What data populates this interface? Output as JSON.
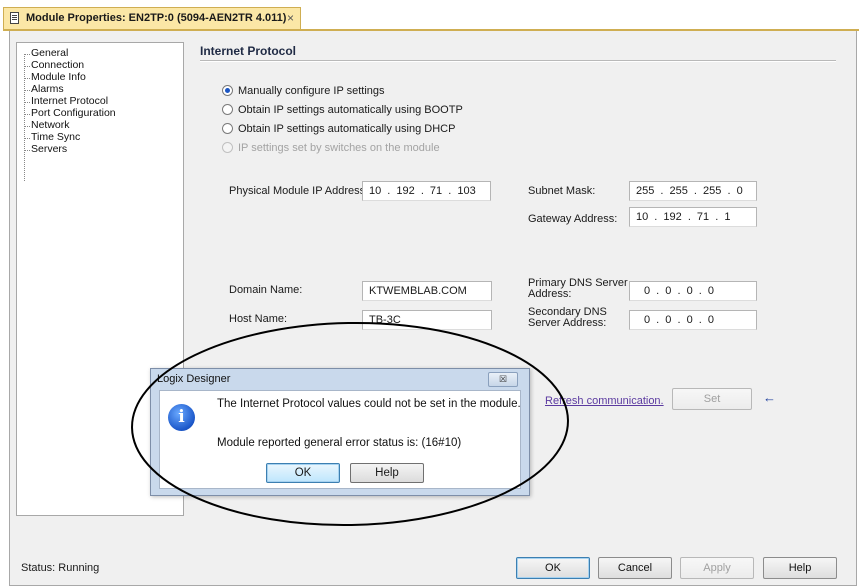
{
  "tab": {
    "title": "Module Properties: EN2TP:0 (5094-AEN2TR 4.011)",
    "close_glyph": "×"
  },
  "tree": {
    "items": [
      "General",
      "Connection",
      "Module Info",
      "Alarms",
      "Internet Protocol",
      "Port Configuration",
      "Network",
      "Time Sync",
      "Servers"
    ]
  },
  "section": {
    "title": "Internet Protocol"
  },
  "radios": [
    {
      "label": "Manually configure IP settings",
      "checked": true,
      "disabled": false
    },
    {
      "label": "Obtain IP settings automatically using BOOTP",
      "checked": false,
      "disabled": false
    },
    {
      "label": "Obtain IP settings automatically using DHCP",
      "checked": false,
      "disabled": false
    },
    {
      "label": "IP settings set by switches on the module",
      "checked": false,
      "disabled": true
    }
  ],
  "fields": {
    "ip_label": "Physical Module IP Address:",
    "ip_value": "10 . 192 . 71 . 103",
    "subnet_label": "Subnet Mask:",
    "subnet_value": "255 . 255 . 255 . 0",
    "gateway_label": "Gateway Address:",
    "gateway_value": "10 . 192 . 71 . 1",
    "domain_label": "Domain Name:",
    "domain_value": "KTWEMBLAB.COM",
    "host_label": "Host Name:",
    "host_value": "TB-3C",
    "primary_dns_label_1": "Primary DNS Server",
    "primary_dns_label_2": "Address:",
    "primary_dns_value": "0 . 0 . 0 . 0",
    "secondary_dns_label_1": "Secondary DNS",
    "secondary_dns_label_2": "Server Address:",
    "secondary_dns_value": "0 . 0 . 0 . 0"
  },
  "actions": {
    "refresh_link": "Refresh communication.",
    "set_button": "Set"
  },
  "dialog": {
    "title": "Logix Designer",
    "close_glyph": "☒",
    "message_1": "The Internet Protocol values could not be set in the module.",
    "message_2": "Module reported general error status is: (16#10)",
    "ok": "OK",
    "help": "Help"
  },
  "footer": {
    "status": "Status:  Running",
    "ok": "OK",
    "cancel": "Cancel",
    "apply": "Apply",
    "help": "Help"
  },
  "colors": {
    "tab_background": "#fbe7a6",
    "dialog_frame": "#c9d9ec",
    "link": "#5b3aa0",
    "radio_selected": "#1b55c2",
    "annotation": "#000000"
  }
}
